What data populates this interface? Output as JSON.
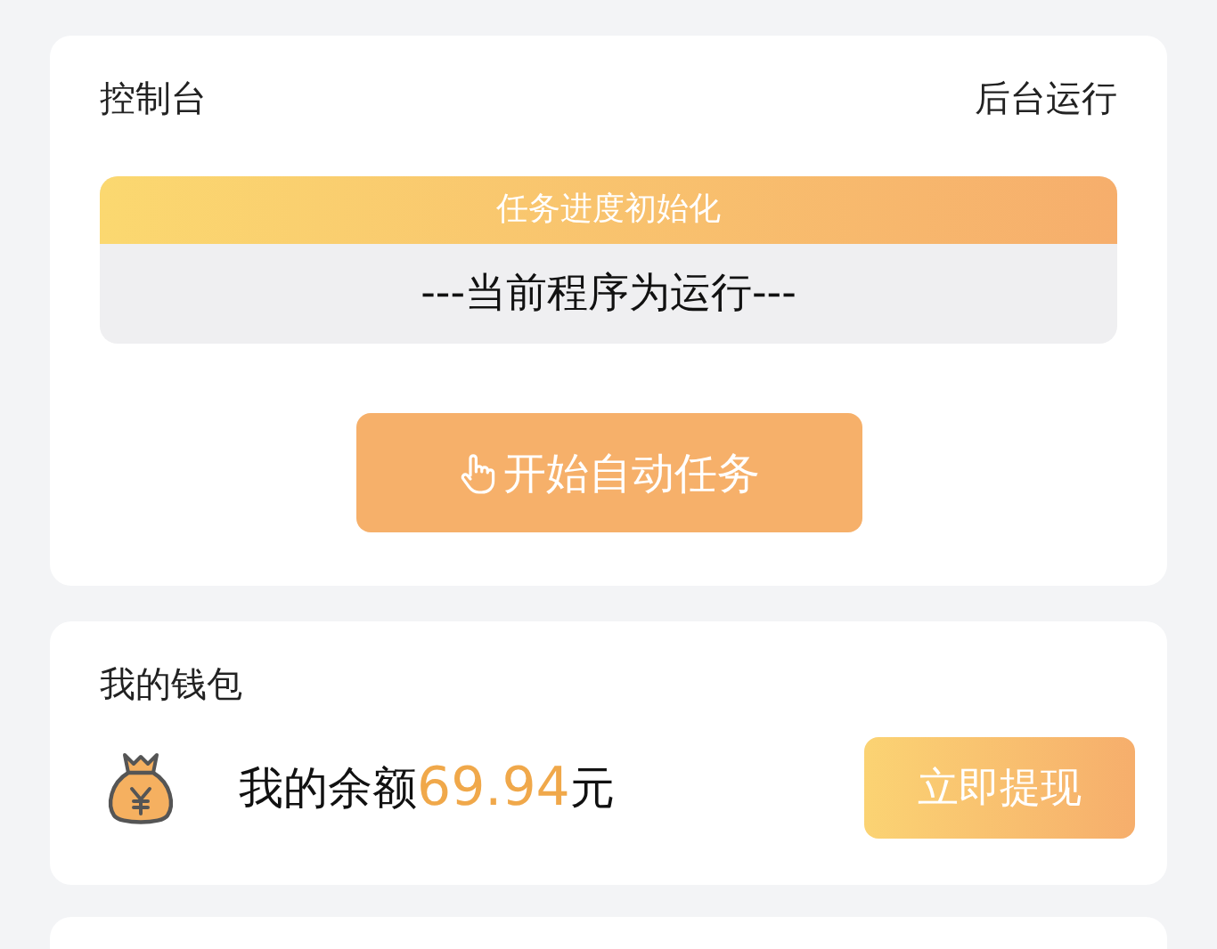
{
  "console": {
    "title": "控制台",
    "action": "后台运行",
    "progress": {
      "title": "任务进度初始化",
      "status": "---当前程序为运行---"
    },
    "start_button": "开始自动任务"
  },
  "wallet": {
    "title": "我的钱包",
    "balance_label": "我的余额",
    "amount": "69.94",
    "unit": "元",
    "withdraw_button": "立即提现"
  }
}
